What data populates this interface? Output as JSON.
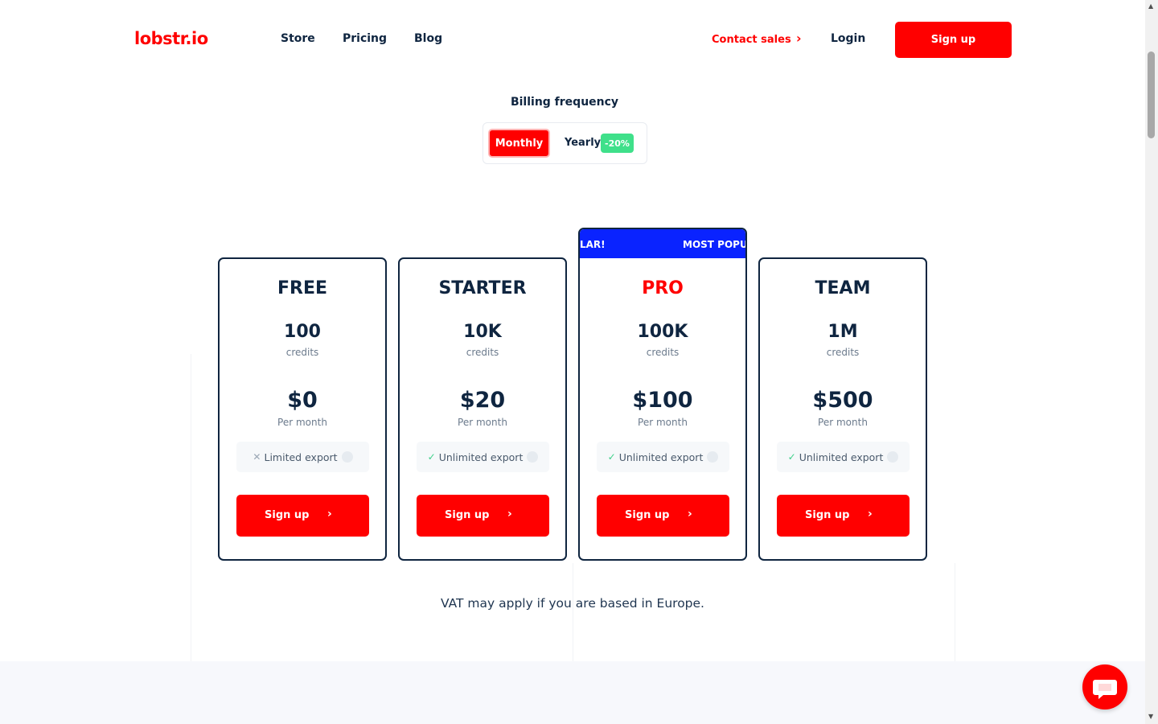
{
  "header": {
    "logo": "lobstr.io",
    "nav": [
      {
        "label": "Store"
      },
      {
        "label": "Pricing"
      },
      {
        "label": "Blog"
      }
    ],
    "contact_sales": "Contact sales",
    "login": "Login",
    "signup": "Sign up"
  },
  "billing": {
    "title": "Billing frequency",
    "monthly": "Monthly",
    "yearly": "Yearly",
    "discount": "-20%",
    "selected": "Monthly"
  },
  "plans": [
    {
      "name": "FREE",
      "credits": "100",
      "credits_label": "credits",
      "price": "$0",
      "period": "Per month",
      "export": "Limited export",
      "export_icon": "x-icon",
      "cta": "Sign up"
    },
    {
      "name": "STARTER",
      "credits": "10K",
      "credits_label": "credits",
      "price": "$20",
      "period": "Per month",
      "export": "Unlimited export",
      "export_icon": "check-icon",
      "cta": "Sign up"
    },
    {
      "name": "PRO",
      "credits": "100K",
      "credits_label": "credits",
      "price": "$100",
      "period": "Per month",
      "export": "Unlimited export",
      "export_icon": "check-icon",
      "cta": "Sign up",
      "banner_left": "LAR!",
      "banner_right": "MOST POPUL"
    },
    {
      "name": "TEAM",
      "credits": "1M",
      "credits_label": "credits",
      "price": "$500",
      "period": "Per month",
      "export": "Unlimited export",
      "export_icon": "check-icon",
      "cta": "Sign up"
    }
  ],
  "vat_note": "VAT may apply if you are based in Europe.",
  "colors": {
    "brand": "#ff0000",
    "text": "#0f2540",
    "banner": "#0a23ff",
    "discount": "#3fe08a"
  }
}
